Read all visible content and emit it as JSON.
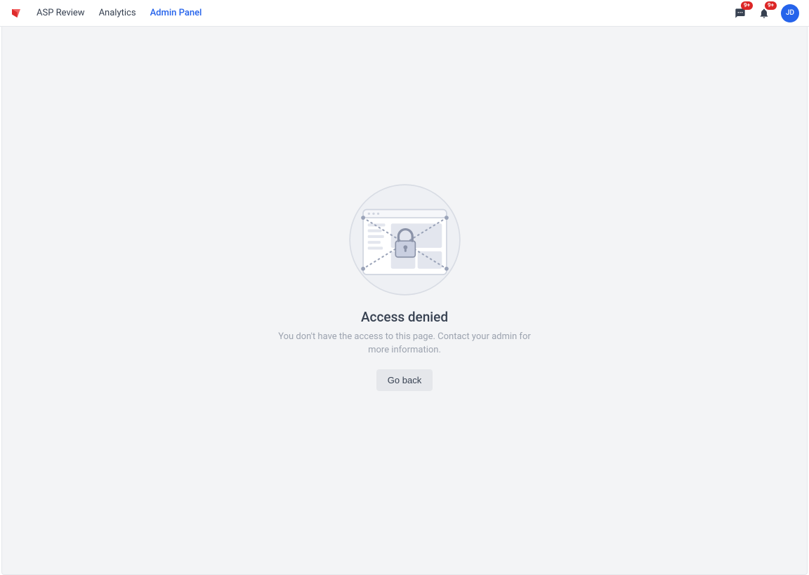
{
  "header": {
    "nav": [
      {
        "label": "ASP Review",
        "active": false
      },
      {
        "label": "Analytics",
        "active": false
      },
      {
        "label": "Admin Panel",
        "active": true
      }
    ],
    "messages_badge": "9+",
    "notifications_badge": "9+",
    "avatar_initials": "JD"
  },
  "empty": {
    "title": "Access denied",
    "subtitle": "You don't have the access to this page. Contact your admin for more information.",
    "button": "Go back"
  }
}
